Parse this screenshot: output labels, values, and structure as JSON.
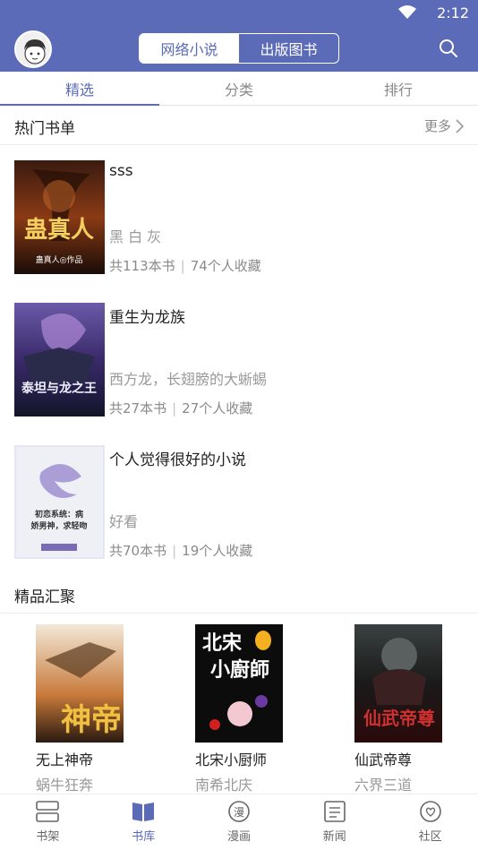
{
  "status_bar": {
    "time": "2:12"
  },
  "header": {
    "segments": [
      "网络小说",
      "出版图书"
    ],
    "active_segment": 0
  },
  "tabs": [
    {
      "label": "精选"
    },
    {
      "label": "分类"
    },
    {
      "label": "排行"
    }
  ],
  "hot_lists": {
    "title": "热门书单",
    "more": "更多",
    "items": [
      {
        "title": "sss",
        "desc": "黑 白 灰",
        "books": "共113本书",
        "favorites": "74个人收藏",
        "cover_text": "蛊真人",
        "cover_sub": "蛊真人◎作品"
      },
      {
        "title": "重生为龙族",
        "desc": "西方龙，长翅膀的大蜥蜴",
        "books": "共27本书",
        "favorites": "27个人收藏",
        "cover_text": "泰坦与龙之王"
      },
      {
        "title": "个人觉得很好的小说",
        "desc": "好看",
        "books": "共70本书",
        "favorites": "19个人收藏",
        "cover_text": "初恋系统：病娇男神，求轻吻"
      }
    ]
  },
  "featured": {
    "title": "精品汇聚",
    "books": [
      {
        "title": "无上神帝",
        "author": "蜗牛狂奔",
        "cover_text": "神帝"
      },
      {
        "title": "北宋小厨师",
        "author": "南希北庆",
        "cover_text": "北宋小厨師"
      },
      {
        "title": "仙武帝尊",
        "author": "六界三道",
        "cover_text": "仙武帝尊"
      }
    ]
  },
  "bottom_nav": [
    {
      "label": "书架",
      "icon": "bookshelf-icon"
    },
    {
      "label": "书库",
      "icon": "book-open-icon"
    },
    {
      "label": "漫画",
      "icon": "comic-icon"
    },
    {
      "label": "新闻",
      "icon": "news-icon"
    },
    {
      "label": "社区",
      "icon": "community-icon"
    }
  ],
  "colors": {
    "primary": "#5b6bb8",
    "text": "#222222",
    "muted": "#999999"
  }
}
